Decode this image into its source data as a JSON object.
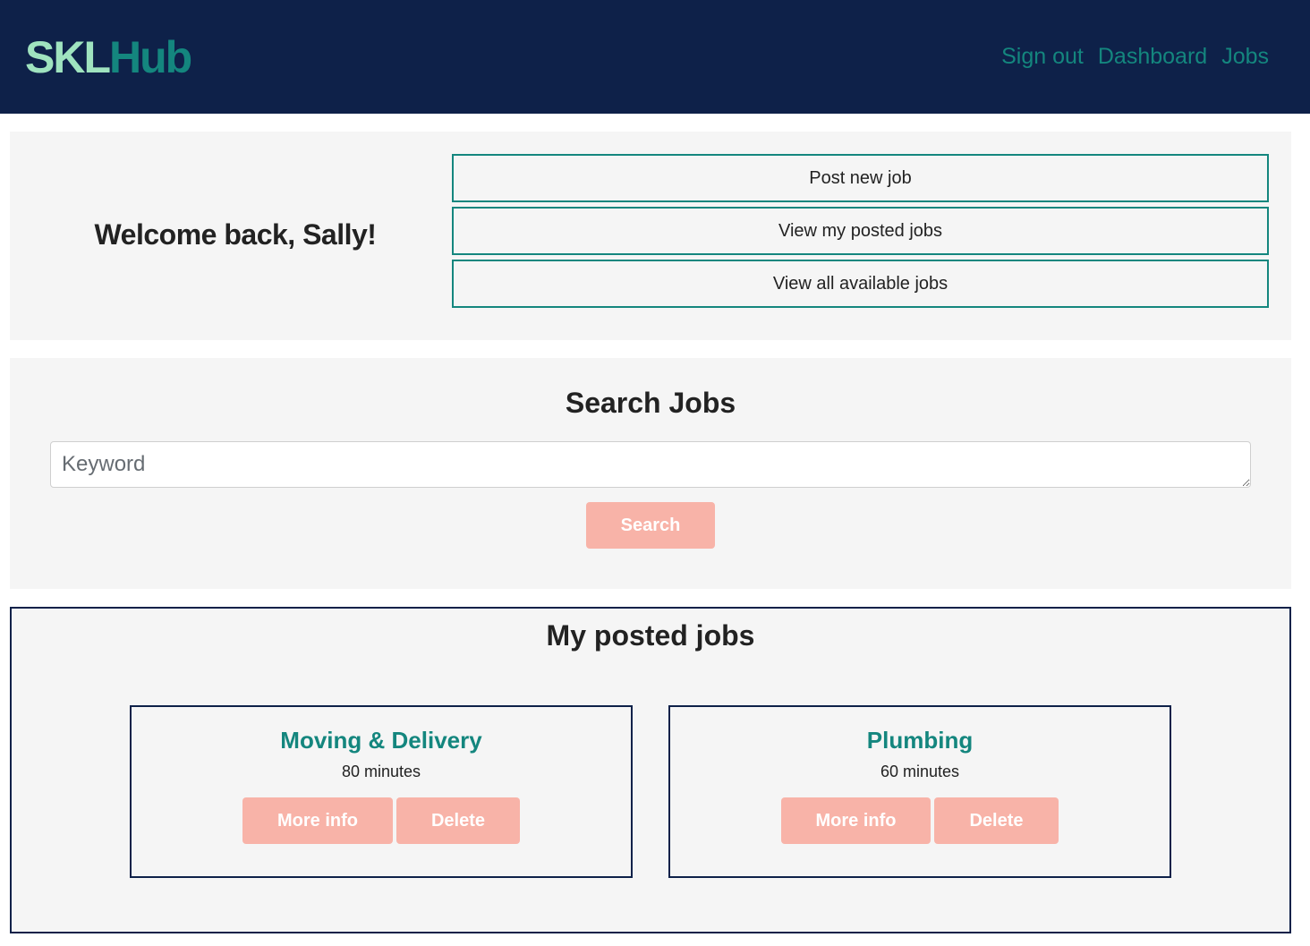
{
  "brand": {
    "part1": "SKL",
    "part2": "Hub"
  },
  "nav": {
    "links": [
      "Sign out",
      "Dashboard",
      "Jobs"
    ]
  },
  "welcome": {
    "message": "Welcome back, Sally!",
    "actions": [
      "Post new job",
      "View my posted jobs",
      "View all available jobs"
    ]
  },
  "search": {
    "title": "Search Jobs",
    "placeholder": "Keyword",
    "value": "",
    "button_label": "Search"
  },
  "posted_jobs": {
    "title": "My posted jobs",
    "jobs": [
      {
        "title": "Moving & Delivery",
        "duration": "80 minutes",
        "more_label": "More info",
        "delete_label": "Delete"
      },
      {
        "title": "Plumbing",
        "duration": "60 minutes",
        "more_label": "More info",
        "delete_label": "Delete"
      }
    ]
  },
  "colors": {
    "navbar_bg": "#0e2149",
    "brand_light": "#9fe3bf",
    "accent_teal": "#14867e",
    "button_salmon": "#f8b3a8",
    "panel_bg": "#f5f5f5"
  }
}
